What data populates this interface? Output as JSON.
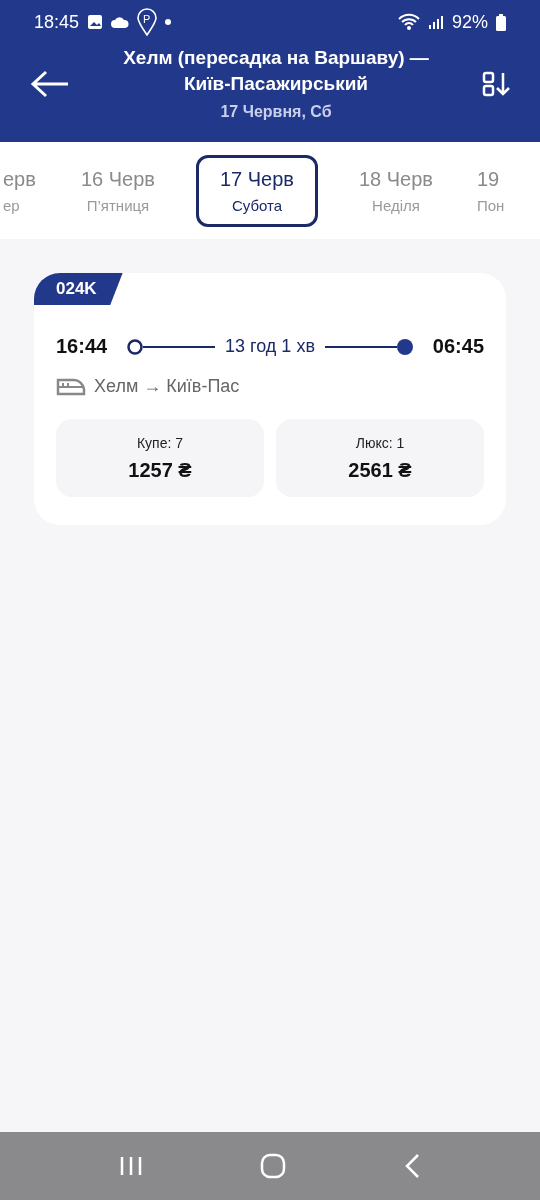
{
  "status_bar": {
    "time": "18:45",
    "parking_label": "P",
    "battery": "92%"
  },
  "header": {
    "title_line_1": "Хелм (пересадка на Варшаву) —",
    "title_line_2": "Київ-Пасажирський",
    "subtitle": "17 Червня, Сб"
  },
  "dates": [
    {
      "date": "ерв",
      "weekday": "ер",
      "selected": false
    },
    {
      "date": "16 Черв",
      "weekday": "П’ятниця",
      "selected": false
    },
    {
      "date": "17 Черв",
      "weekday": "Субота",
      "selected": true
    },
    {
      "date": "18 Черв",
      "weekday": "Неділя",
      "selected": false
    },
    {
      "date": "19",
      "weekday": "Пон",
      "selected": false
    }
  ],
  "trains": [
    {
      "number": "024K",
      "departure": "16:44",
      "duration": "13 год 1 хв",
      "arrival": "06:45",
      "route": "Хелм → Київ-Пас",
      "classes": [
        {
          "name": "Купе: 7",
          "price": "1257 ₴"
        },
        {
          "name": "Люкс: 1",
          "price": "2561 ₴"
        }
      ]
    }
  ]
}
